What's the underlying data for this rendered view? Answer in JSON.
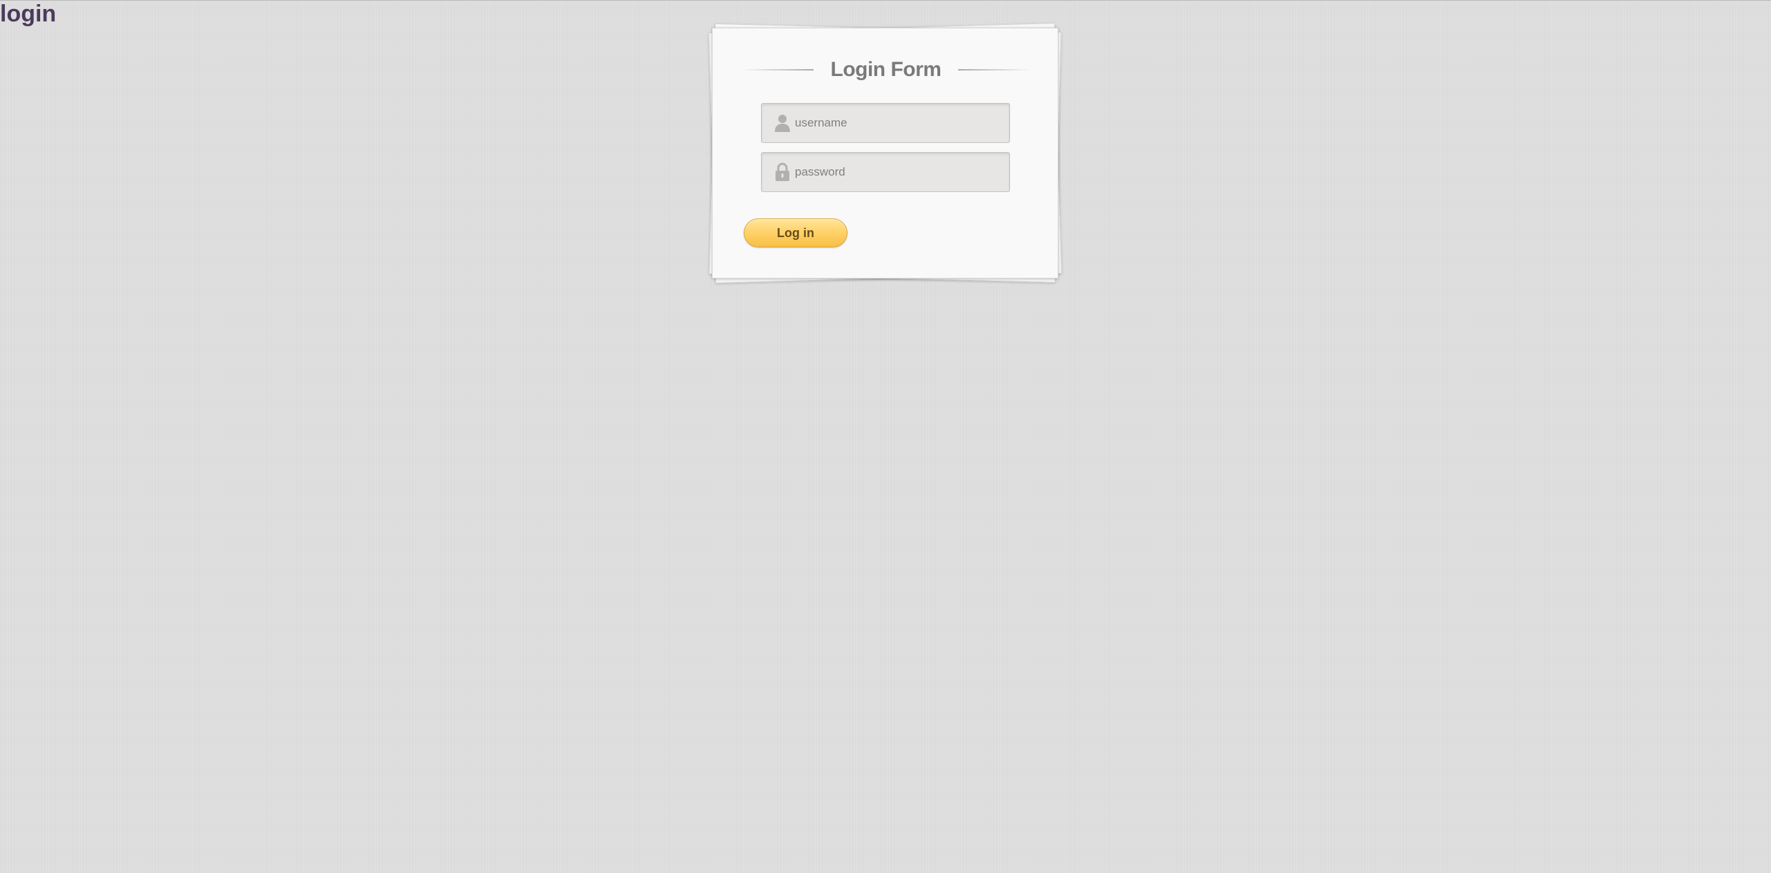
{
  "page": {
    "heading": "login"
  },
  "form": {
    "title": "Login Form",
    "username": {
      "placeholder": "username",
      "value": "",
      "icon": "user-icon"
    },
    "password": {
      "placeholder": "password",
      "value": "",
      "icon": "lock-icon"
    },
    "submit_label": "Log in"
  },
  "colors": {
    "background": "#dedede",
    "heading": "#4c3a5e",
    "button": "#ffd36c",
    "button_text": "#6a4a18"
  }
}
